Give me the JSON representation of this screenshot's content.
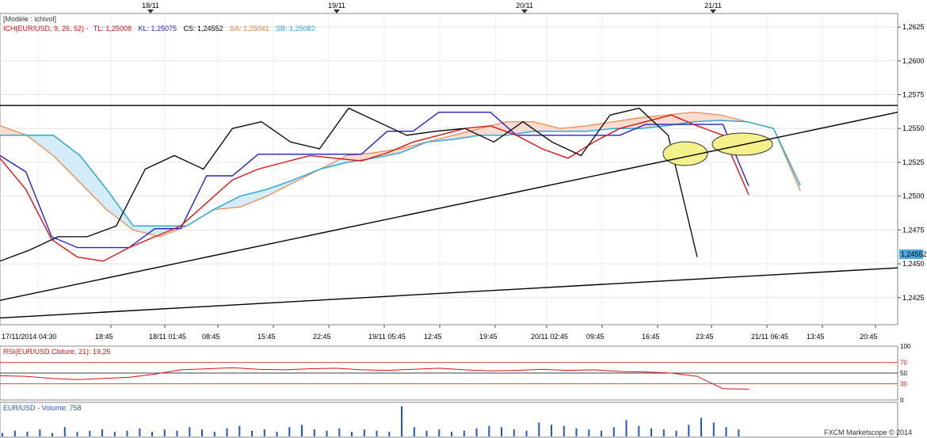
{
  "top_dates": [
    "18/11",
    "19/11",
    "20/11",
    "21/11"
  ],
  "legend": {
    "model": "[Modèle : ichivol]",
    "ich_label": "ICH(EUR/USD, 9, 26, 52)  -",
    "tl": "TL: 1,25008",
    "kl": "KL: 1,25075",
    "cs": "CS: 1,24552",
    "sa": "SA: 1,25041",
    "sb": "SB: 1,25082"
  },
  "price_axis": {
    "ticks": [
      "1,2625",
      "1,2600",
      "1,2575",
      "1,2550",
      "1,2525",
      "1,2500",
      "1,2475",
      "1,2450",
      "1,2425"
    ],
    "current": "1,24552"
  },
  "time_axis": {
    "labels": [
      "17/11/2014 04:30",
      "18:45",
      "18/11 01:45",
      "08:45",
      "15:45",
      "22:45",
      "19/11 05:45",
      "12:45",
      "19:45",
      "20/11 02:45",
      "09:45",
      "16:45",
      "23:45",
      "21/11 06:45",
      "13:45",
      "20:45"
    ]
  },
  "rsi": {
    "label": "RSI(EUR/USD.Cloture, 21): 19,25",
    "levels": [
      "100",
      "70",
      "50",
      "30",
      "0"
    ]
  },
  "volume": {
    "label": "EUR/USD - Volume: 758"
  },
  "credit": "FXCM Marketscope © 2014",
  "colors": {
    "price": "#e01010",
    "tenkan": "#e01010",
    "kijun": "#2222cc",
    "chikou": "#000000",
    "senkou_a": "#f08040",
    "senkou_b": "#30a8d8",
    "cloud_bull": "#fcdcd0",
    "cloud_bear": "#d4ecf8",
    "rsi": "#e01010",
    "volume": "#2255cc",
    "highlight": "#f4f08a"
  },
  "chart_data": {
    "type": "line",
    "instrument": "EUR/USD",
    "series": [
      {
        "name": "TL",
        "last": 1.25008,
        "values": [
          1.2528,
          1.2505,
          1.2468,
          1.2455,
          1.2452,
          1.2462,
          1.247,
          1.2478,
          1.2495,
          1.2512,
          1.252,
          1.2525,
          1.253,
          1.2528,
          1.2526,
          1.2532,
          1.254,
          1.2545,
          1.255,
          1.2552,
          1.2545,
          1.2535,
          1.2528,
          1.254,
          1.255,
          1.2555,
          1.256,
          1.2552,
          1.2545,
          1.2501
        ]
      },
      {
        "name": "KL",
        "last": 1.25075,
        "values": [
          1.253,
          1.2518,
          1.247,
          1.2462,
          1.2462,
          1.2462,
          1.2476,
          1.2476,
          1.2515,
          1.2515,
          1.2531,
          1.2531,
          1.2531,
          1.2531,
          1.2531,
          1.2548,
          1.2548,
          1.2562,
          1.2562,
          1.2562,
          1.2545,
          1.2545,
          1.2545,
          1.2545,
          1.2545,
          1.2553,
          1.2553,
          1.2553,
          1.2553,
          1.25075
        ]
      },
      {
        "name": "CS",
        "last": 1.24552,
        "values": [
          1.2452,
          1.246,
          1.247,
          1.247,
          1.2478,
          1.252,
          1.253,
          1.252,
          1.255,
          1.2555,
          1.254,
          1.2535,
          1.2565,
          1.2555,
          1.2545,
          1.2548,
          1.255,
          1.254,
          1.2555,
          1.254,
          1.253,
          1.256,
          1.2565,
          1.2545,
          1.2455
        ]
      },
      {
        "name": "SA",
        "last": 1.25041,
        "values": [
          1.2552,
          1.2545,
          1.253,
          1.251,
          1.249,
          1.2475,
          1.247,
          1.2478,
          1.249,
          1.2492,
          1.25,
          1.251,
          1.252,
          1.253,
          1.2532,
          1.2535,
          1.254,
          1.2545,
          1.255,
          1.2555,
          1.2555,
          1.255,
          1.2552,
          1.2555,
          1.2558,
          1.256,
          1.2562,
          1.256,
          1.2555,
          1.255,
          1.2504
        ]
      },
      {
        "name": "SB",
        "last": 1.25082,
        "values": [
          1.2545,
          1.2545,
          1.2545,
          1.253,
          1.2505,
          1.2478,
          1.2478,
          1.2478,
          1.249,
          1.25,
          1.2505,
          1.2512,
          1.252,
          1.2525,
          1.2528,
          1.2532,
          1.254,
          1.2542,
          1.2545,
          1.2545,
          1.2548,
          1.2548,
          1.2548,
          1.255,
          1.255,
          1.2552,
          1.2555,
          1.2556,
          1.2555,
          1.255,
          1.2508
        ]
      }
    ],
    "ylim": [
      1.2405,
      1.2635
    ],
    "y_ticks": [
      1.2425,
      1.245,
      1.2475,
      1.25,
      1.2525,
      1.255,
      1.2575,
      1.26,
      1.2625
    ],
    "trendlines": [
      {
        "from": 1.2423,
        "to": 1.2562
      },
      {
        "from": 1.241,
        "to": 1.2447
      },
      {
        "from": 1.2567,
        "to": 1.2567
      }
    ],
    "rsi_values": [
      45,
      44,
      40,
      38,
      40,
      42,
      48,
      56,
      58,
      60,
      57,
      56,
      58,
      59,
      56,
      55,
      57,
      59,
      56,
      54,
      55,
      57,
      55,
      56,
      53,
      52,
      50,
      44,
      21,
      20
    ],
    "volume_values": [
      3,
      5,
      4,
      6,
      3,
      8,
      4,
      5,
      6,
      4,
      5,
      7,
      4,
      6,
      5,
      8,
      6,
      4,
      7,
      9,
      5,
      6,
      4,
      8,
      10,
      6,
      5,
      7,
      4,
      6,
      5,
      4,
      26,
      8,
      5,
      6,
      4,
      5,
      7,
      9,
      8,
      6,
      5,
      12,
      10,
      9,
      7,
      6,
      5,
      8,
      14,
      9,
      7,
      6,
      5,
      10,
      16,
      12,
      8,
      6
    ]
  }
}
